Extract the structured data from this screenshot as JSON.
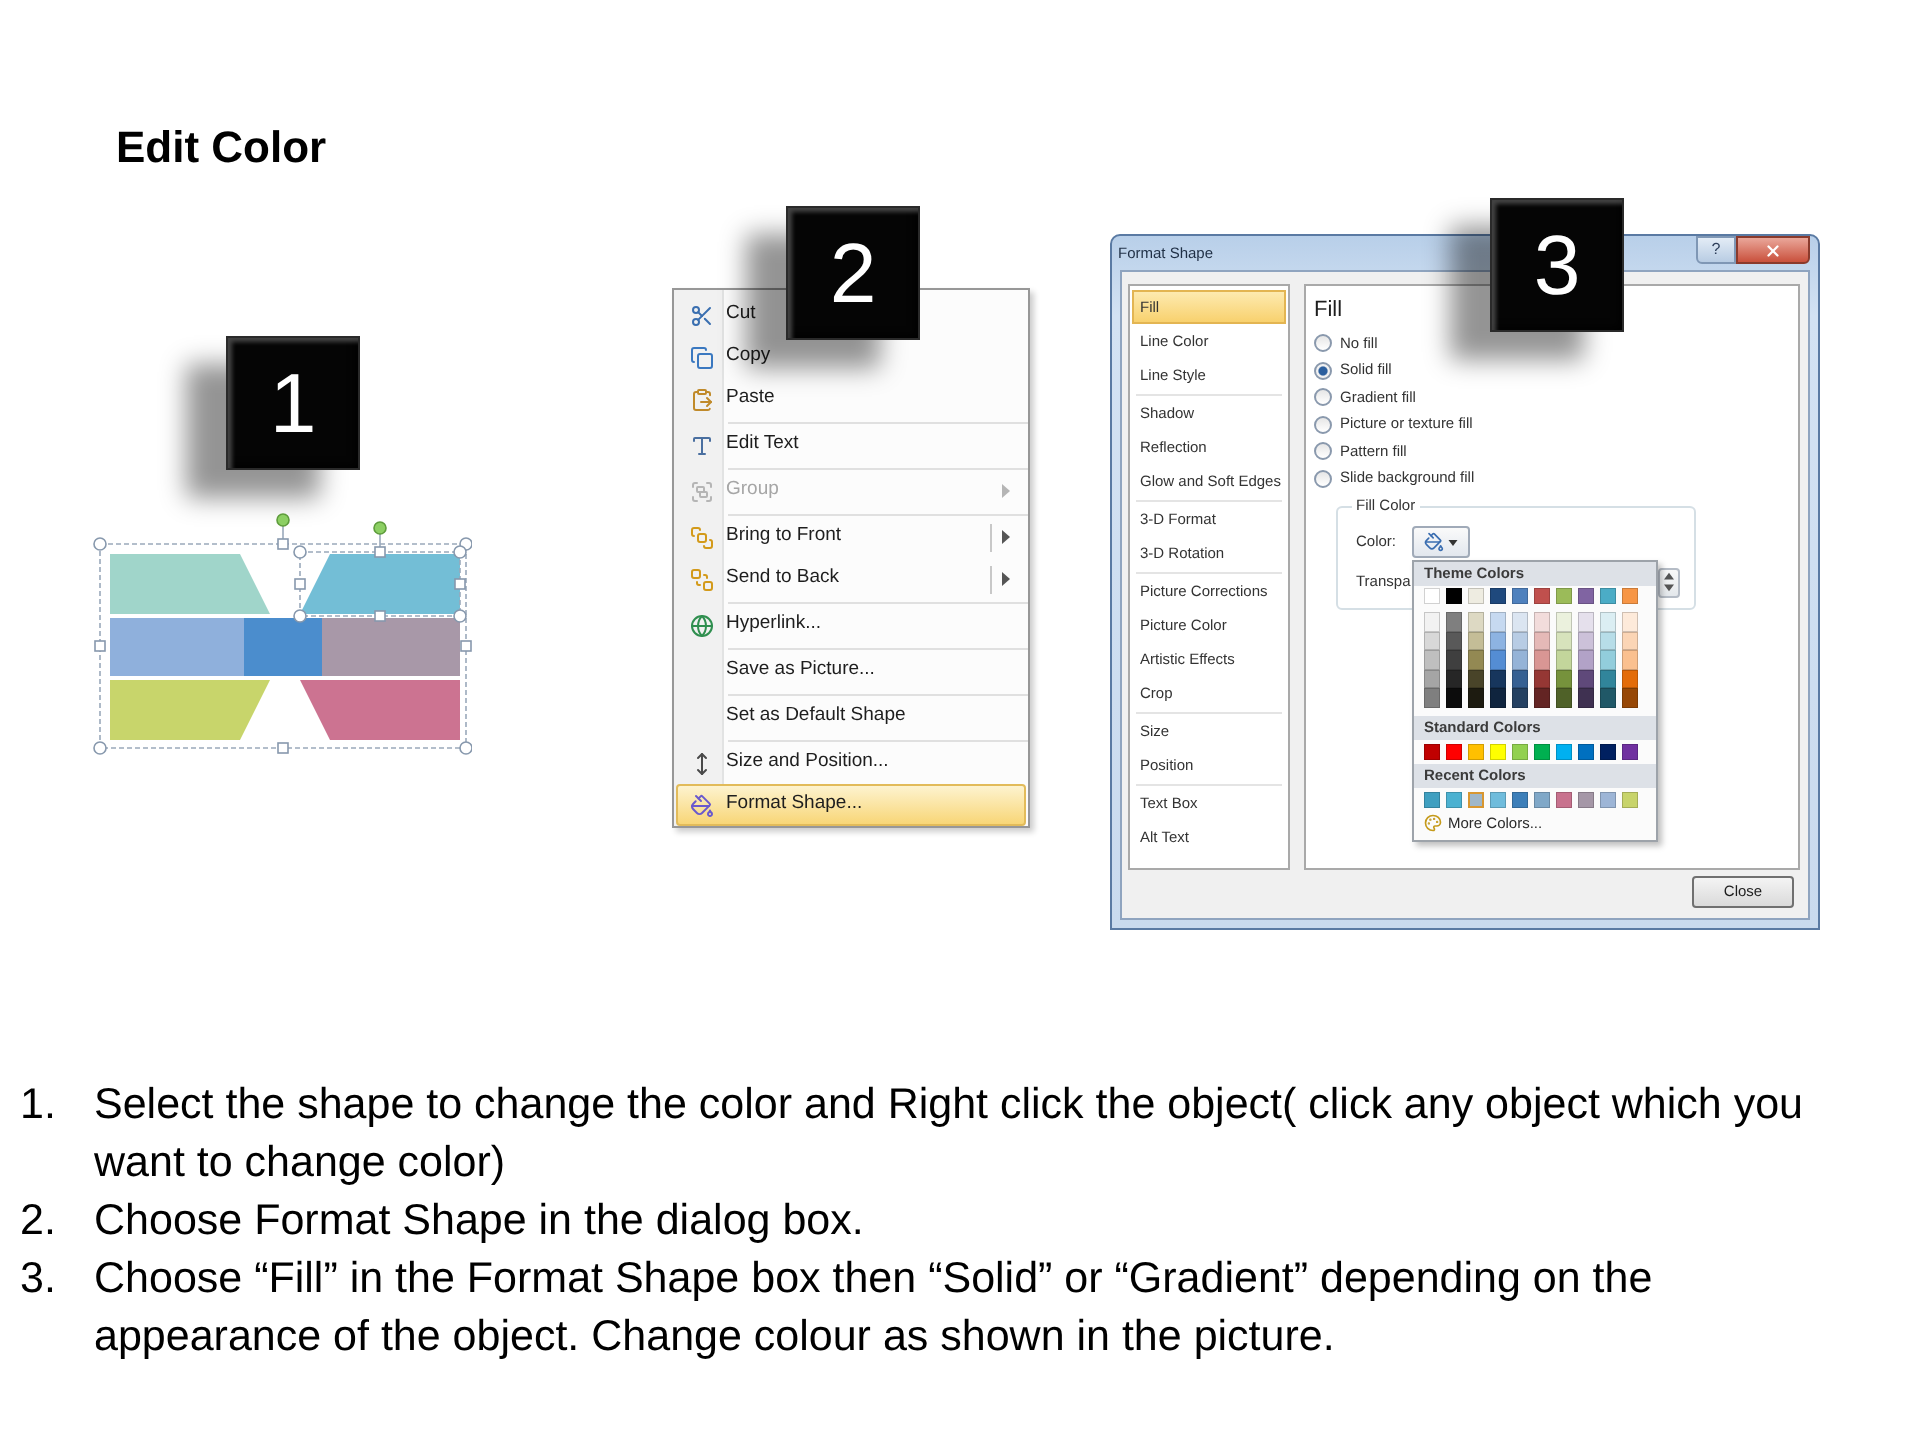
{
  "title": "Edit Color",
  "diagram": {
    "badge": "1",
    "group_selected": true,
    "segments": [
      {
        "color": "#a0d5ca",
        "selected": false
      },
      {
        "color": "#73bed6",
        "selected": true
      },
      {
        "color": "#8fb0dc",
        "selected": false
      },
      {
        "color": "#4b8dcd",
        "selected": false
      },
      {
        "color": "#a898a8",
        "selected": false
      },
      {
        "color": "#c8d56b",
        "selected": false
      },
      {
        "color": "#cc7391",
        "selected": false
      }
    ]
  },
  "context_menu": {
    "badge": "2",
    "sections": [
      {
        "items": [
          {
            "label": "Cut",
            "kind": "plain",
            "disabled": false,
            "selected": false
          },
          {
            "label": "Copy",
            "kind": "plain",
            "disabled": false,
            "selected": false
          },
          {
            "label": "Paste",
            "kind": "plain",
            "disabled": false,
            "selected": false
          }
        ]
      },
      {
        "items": [
          {
            "label": "Edit Text",
            "kind": "plain",
            "disabled": false,
            "selected": false
          }
        ]
      },
      {
        "items": [
          {
            "label": "Group",
            "kind": "submenu",
            "disabled": true,
            "selected": false
          }
        ]
      },
      {
        "items": [
          {
            "label": "Bring to Front",
            "kind": "split_submenu",
            "disabled": false,
            "selected": false
          },
          {
            "label": "Send to Back",
            "kind": "split_submenu",
            "disabled": false,
            "selected": false
          }
        ]
      },
      {
        "items": [
          {
            "label": "Hyperlink...",
            "kind": "plain",
            "disabled": false,
            "selected": false
          }
        ]
      },
      {
        "items": [
          {
            "label": "Save as Picture...",
            "kind": "plain",
            "disabled": false,
            "selected": false
          }
        ]
      },
      {
        "items": [
          {
            "label": "Set as Default Shape",
            "kind": "plain",
            "disabled": false,
            "selected": false
          }
        ]
      },
      {
        "items": [
          {
            "label": "Size and Position...",
            "kind": "plain",
            "disabled": false,
            "selected": false
          },
          {
            "label": "Format Shape...",
            "kind": "plain",
            "disabled": false,
            "selected": true
          }
        ]
      }
    ]
  },
  "format_dialog": {
    "badge": "3",
    "title": "Format Shape",
    "help_button": "?",
    "categories": [
      {
        "items": [
          {
            "label": "Fill",
            "selected": true
          },
          {
            "label": "Line Color",
            "selected": false
          },
          {
            "label": "Line Style",
            "selected": false
          }
        ]
      },
      {
        "items": [
          {
            "label": "Shadow",
            "selected": false
          },
          {
            "label": "Reflection",
            "selected": false
          },
          {
            "label": "Glow and Soft Edges",
            "selected": false
          }
        ]
      },
      {
        "items": [
          {
            "label": "3-D Format",
            "selected": false
          },
          {
            "label": "3-D Rotation",
            "selected": false
          }
        ]
      },
      {
        "items": [
          {
            "label": "Picture Corrections",
            "selected": false
          },
          {
            "label": "Picture Color",
            "selected": false
          },
          {
            "label": "Artistic Effects",
            "selected": false
          },
          {
            "label": "Crop",
            "selected": false
          }
        ]
      },
      {
        "items": [
          {
            "label": "Size",
            "selected": false
          },
          {
            "label": "Position",
            "selected": false
          }
        ]
      },
      {
        "items": [
          {
            "label": "Text Box",
            "selected": false
          },
          {
            "label": "Alt Text",
            "selected": false
          }
        ]
      }
    ],
    "fill": {
      "heading": "Fill",
      "options": [
        {
          "label": "No fill",
          "selected": false
        },
        {
          "label": "Solid fill",
          "selected": true
        },
        {
          "label": "Gradient fill",
          "selected": false
        },
        {
          "label": "Picture or texture fill",
          "selected": false
        },
        {
          "label": "Pattern fill",
          "selected": false
        },
        {
          "label": "Slide background fill",
          "selected": false
        }
      ],
      "fill_color": {
        "legend": "Fill Color",
        "color_label": "Color:",
        "transparency_label": "Transpa"
      }
    },
    "color_popup": {
      "theme_heading": "Theme Colors",
      "theme_row": [
        {
          "color": "#ffffff"
        },
        {
          "color": "#000000"
        },
        {
          "color": "#eeece1"
        },
        {
          "color": "#1f497d"
        },
        {
          "color": "#4f81bd"
        },
        {
          "color": "#c0504d"
        },
        {
          "color": "#9bbb59"
        },
        {
          "color": "#8064a2"
        },
        {
          "color": "#4bacc6"
        },
        {
          "color": "#f79646"
        }
      ],
      "shade_rows": [
        {
          "swatches": [
            {
              "color": "#f2f2f2"
            },
            {
              "color": "#7f7f7f"
            },
            {
              "color": "#ddd9c3"
            },
            {
              "color": "#c6d9f0"
            },
            {
              "color": "#dbe5f1"
            },
            {
              "color": "#f2dcdb"
            },
            {
              "color": "#ebf1dd"
            },
            {
              "color": "#e5e0ec"
            },
            {
              "color": "#dbeef3"
            },
            {
              "color": "#fdeada"
            }
          ]
        },
        {
          "swatches": [
            {
              "color": "#d8d8d8"
            },
            {
              "color": "#595959"
            },
            {
              "color": "#c4bd97"
            },
            {
              "color": "#8db3e2"
            },
            {
              "color": "#b8cce4"
            },
            {
              "color": "#e5b9b7"
            },
            {
              "color": "#d7e3bc"
            },
            {
              "color": "#ccc1d9"
            },
            {
              "color": "#b7dde8"
            },
            {
              "color": "#fbd5b5"
            }
          ]
        },
        {
          "swatches": [
            {
              "color": "#bfbfbf"
            },
            {
              "color": "#3f3f3f"
            },
            {
              "color": "#938953"
            },
            {
              "color": "#548dd4"
            },
            {
              "color": "#95b3d7"
            },
            {
              "color": "#d99694"
            },
            {
              "color": "#c3d69b"
            },
            {
              "color": "#b2a2c7"
            },
            {
              "color": "#92cddc"
            },
            {
              "color": "#fac08f"
            }
          ]
        },
        {
          "swatches": [
            {
              "color": "#a5a5a5"
            },
            {
              "color": "#262626"
            },
            {
              "color": "#494429"
            },
            {
              "color": "#17365d"
            },
            {
              "color": "#366092"
            },
            {
              "color": "#953734"
            },
            {
              "color": "#76923c"
            },
            {
              "color": "#5f497a"
            },
            {
              "color": "#31859b"
            },
            {
              "color": "#e36c09"
            }
          ]
        },
        {
          "swatches": [
            {
              "color": "#7f7f7f"
            },
            {
              "color": "#0c0c0c"
            },
            {
              "color": "#1d1b10"
            },
            {
              "color": "#0f243e"
            },
            {
              "color": "#244061"
            },
            {
              "color": "#632423"
            },
            {
              "color": "#4f6128"
            },
            {
              "color": "#3f3151"
            },
            {
              "color": "#205867"
            },
            {
              "color": "#974806"
            }
          ]
        }
      ],
      "standard_heading": "Standard Colors",
      "standard": [
        {
          "color": "#c00000"
        },
        {
          "color": "#ff0000"
        },
        {
          "color": "#ffc000"
        },
        {
          "color": "#ffff00"
        },
        {
          "color": "#92d050"
        },
        {
          "color": "#00b050"
        },
        {
          "color": "#00b0f0"
        },
        {
          "color": "#0070c0"
        },
        {
          "color": "#002060"
        },
        {
          "color": "#7030a0"
        }
      ],
      "recent_heading": "Recent Colors",
      "recent": [
        {
          "color": "#3f9fc0",
          "selected": false
        },
        {
          "color": "#4bb1d1",
          "selected": false
        },
        {
          "color": "#9fb6c8",
          "selected": true
        },
        {
          "color": "#6fbcdc",
          "selected": false
        },
        {
          "color": "#3d7fb9",
          "selected": false
        },
        {
          "color": "#80a8c8",
          "selected": false
        },
        {
          "color": "#c8728e",
          "selected": false
        },
        {
          "color": "#a597a7",
          "selected": false
        },
        {
          "color": "#9db5d6",
          "selected": false
        },
        {
          "color": "#c8d46b",
          "selected": false
        }
      ],
      "more": "More Colors..."
    },
    "close_button": "Close"
  },
  "steps": [
    {
      "number": "1.",
      "text": "Select the shape to change the color and Right click the object( click any object which you want to change color)"
    },
    {
      "number": "2.",
      "text": "Choose Format Shape in the dialog box."
    },
    {
      "number": "3.",
      "text": "Choose “Fill” in the Format Shape box then “Solid” or “Gradient” depending on the appearance of the object. Change colour as shown in the picture."
    }
  ]
}
